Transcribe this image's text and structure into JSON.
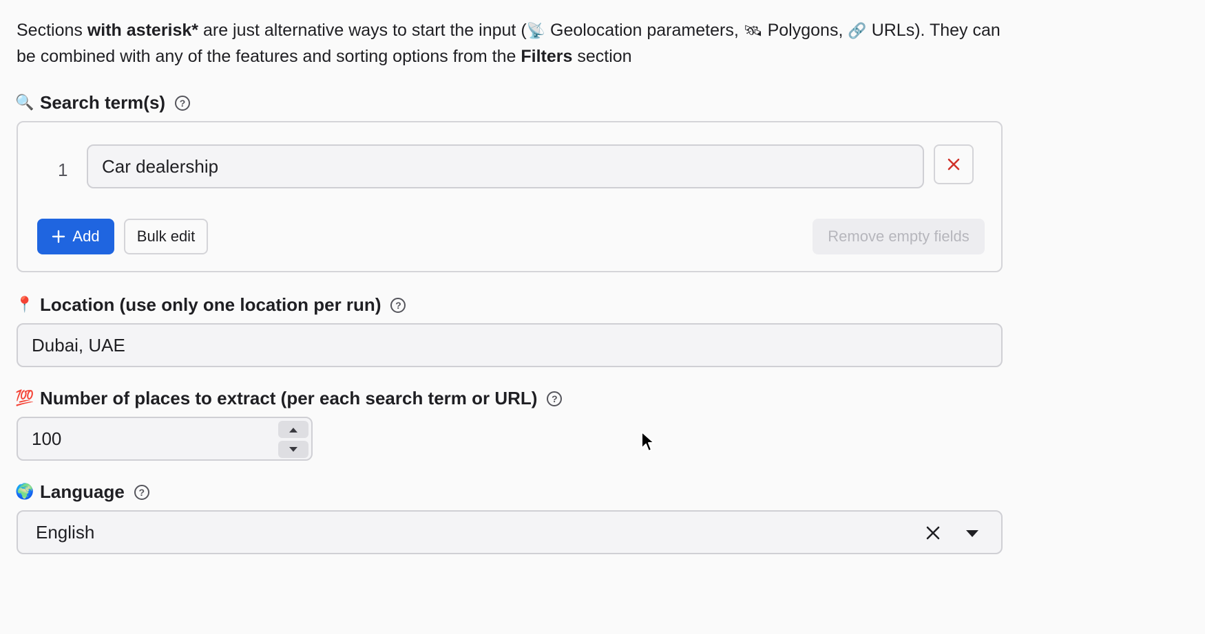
{
  "intro": {
    "text_1": "Sections ",
    "bold_1": "with asterisk*",
    "text_2": " are just alternative ways to start the input (",
    "icon_geo": "📡",
    "text_3": " Geolocation parameters, ",
    "icon_poly": "🛰",
    "text_4": " Polygons, ",
    "icon_url": "🔗",
    "text_5": " URLs). They can be combined with any of the features and sorting options from the ",
    "bold_2": "Filters",
    "text_6": " section"
  },
  "search_terms": {
    "label": "Search term(s)",
    "icon": "🔍",
    "rows": [
      {
        "number": "1",
        "value": "Car dealership"
      }
    ],
    "add_label": "Add",
    "bulk_label": "Bulk edit",
    "remove_empty_label": "Remove empty fields"
  },
  "location": {
    "label": "Location (use only one location per run)",
    "icon": "📍",
    "value": "Dubai, UAE"
  },
  "max_places": {
    "label": "Number of places to extract (per each search term or URL)",
    "icon": "💯",
    "value": "100"
  },
  "language": {
    "label": "Language",
    "icon": "🌍",
    "value": "English"
  },
  "help_glyph": "?",
  "colors": {
    "primary": "#1f65e0",
    "delete": "#d0322a",
    "border": "#d4d4d8",
    "field_bg": "#f4f4f6"
  }
}
